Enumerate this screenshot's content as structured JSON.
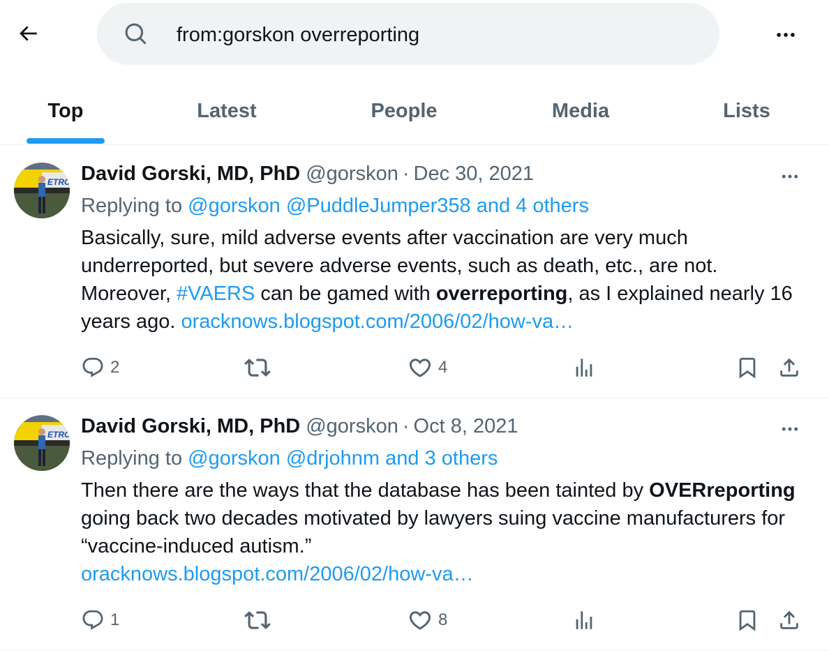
{
  "search": {
    "query": "from:gorskon overreporting"
  },
  "tabs": [
    {
      "label": "Top",
      "active": true
    },
    {
      "label": "Latest",
      "active": false
    },
    {
      "label": "People",
      "active": false
    },
    {
      "label": "Media",
      "active": false
    },
    {
      "label": "Lists",
      "active": false
    }
  ],
  "tweets": [
    {
      "name": "David Gorski, MD, PhD",
      "handle": "@gorskon",
      "sep": "·",
      "date": "Dec 30, 2021",
      "replying_prefix": "Replying to",
      "replying_to": [
        "@gorskon",
        "@PuddleJumper358",
        "and 4 others"
      ],
      "body": {
        "t1": "Basically, sure, mild adverse events after vaccination are very much underreported, but severe adverse events, such as death, etc., are not. Moreover, ",
        "hashtag": "#VAERS",
        "t2": " can be gamed with ",
        "bold": "overreporting",
        "t3": ", as I explained nearly 16 years ago. ",
        "link": "oracknows.blogspot.com/2006/02/how-va…"
      },
      "replies": "2",
      "retweets": "",
      "likes": "4"
    },
    {
      "name": "David Gorski, MD, PhD",
      "handle": "@gorskon",
      "sep": "·",
      "date": "Oct 8, 2021",
      "replying_prefix": "Replying to",
      "replying_to": [
        "@gorskon",
        "@drjohnm",
        "and 3 others"
      ],
      "body": {
        "t1": "Then there are the ways that the database has been tainted by ",
        "bold": "OVERreporting",
        "t2": " going back two decades motivated by lawyers suing vaccine manufacturers for “vaccine-induced autism.” ",
        "link": "oracknows.blogspot.com/2006/02/how-va…"
      },
      "replies": "1",
      "retweets": "",
      "likes": "8"
    }
  ],
  "colors": {
    "accent": "#1d9bf0",
    "secondary_text": "#536471",
    "search_bg": "#eff3f4"
  }
}
